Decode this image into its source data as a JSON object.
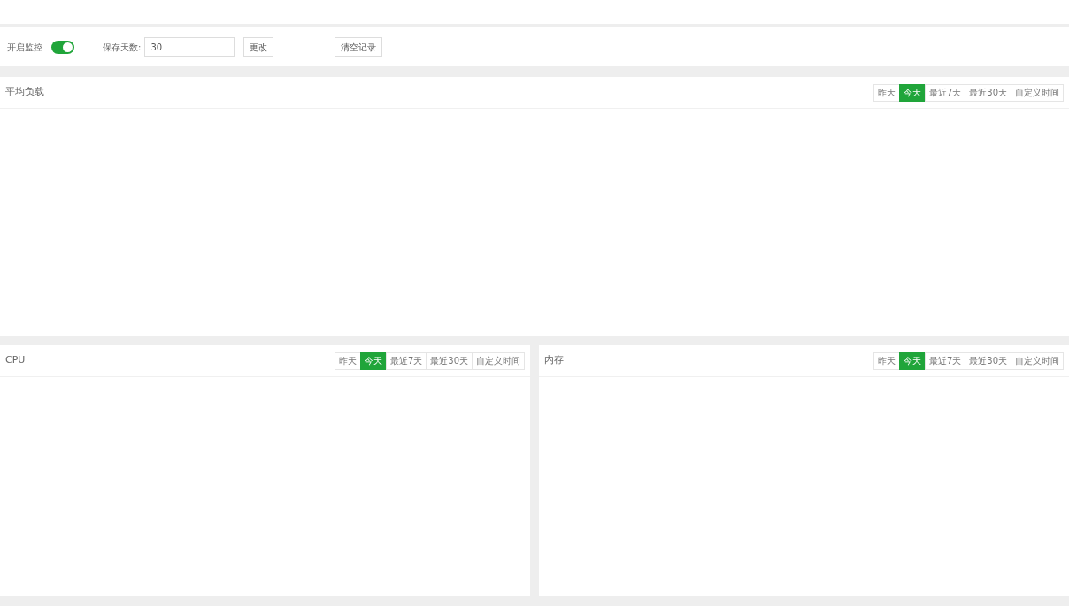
{
  "toolbar": {
    "monitor_label": "开启监控",
    "monitor_on": true,
    "days_label": "保存天数:",
    "days_value": "30",
    "change_button": "更改",
    "clear_button": "清空记录"
  },
  "panels": [
    {
      "title": "平均负载",
      "ranges": [
        {
          "label": "昨天",
          "selected": false
        },
        {
          "label": "今天",
          "selected": true
        },
        {
          "label": "最近7天",
          "selected": false
        },
        {
          "label": "最近30天",
          "selected": false
        },
        {
          "label": "自定义时间",
          "selected": false
        }
      ]
    },
    {
      "title": "CPU",
      "ranges": [
        {
          "label": "昨天",
          "selected": false
        },
        {
          "label": "今天",
          "selected": true
        },
        {
          "label": "最近7天",
          "selected": false
        },
        {
          "label": "最近30天",
          "selected": false
        },
        {
          "label": "自定义时间",
          "selected": false
        }
      ]
    },
    {
      "title": "内存",
      "ranges": [
        {
          "label": "昨天",
          "selected": false
        },
        {
          "label": "今天",
          "selected": true
        },
        {
          "label": "最近7天",
          "selected": false
        },
        {
          "label": "最近30天",
          "selected": false
        },
        {
          "label": "自定义时间",
          "selected": false
        }
      ]
    }
  ]
}
